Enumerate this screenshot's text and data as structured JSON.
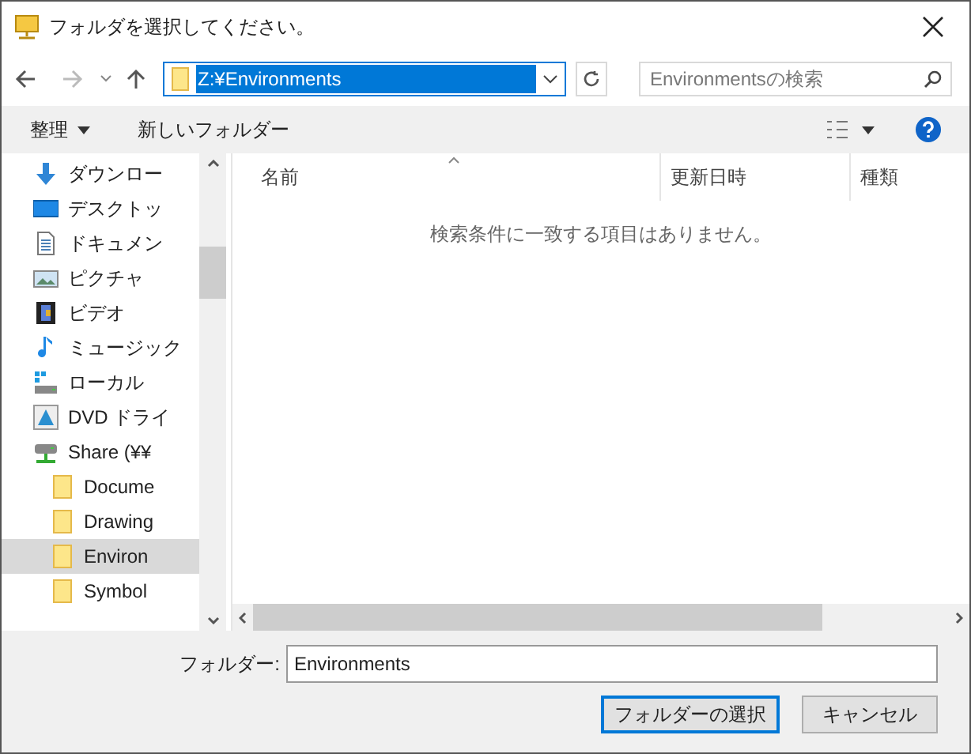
{
  "window": {
    "title": "フォルダを選択してください。"
  },
  "address": {
    "value": "Z:¥Environments"
  },
  "search": {
    "placeholder": "Environmentsの検索"
  },
  "toolbar": {
    "organize": "整理",
    "new_folder": "新しいフォルダー"
  },
  "nav": [
    {
      "label": "ダウンロー",
      "kind": "download",
      "selected": false
    },
    {
      "label": "デスクトッ",
      "kind": "desktop",
      "selected": false
    },
    {
      "label": "ドキュメン",
      "kind": "document",
      "selected": false
    },
    {
      "label": "ピクチャ",
      "kind": "picture",
      "selected": false
    },
    {
      "label": "ビデオ",
      "kind": "video",
      "selected": false
    },
    {
      "label": "ミュージック",
      "kind": "music",
      "selected": false
    },
    {
      "label": "ローカル",
      "kind": "drive",
      "selected": false
    },
    {
      "label": "DVD ドライ",
      "kind": "dvd",
      "selected": false
    },
    {
      "label": "Share (¥¥",
      "kind": "network",
      "selected": false,
      "children": [
        {
          "label": "Docume",
          "kind": "folder",
          "selected": false
        },
        {
          "label": "Drawing",
          "kind": "folder",
          "selected": false
        },
        {
          "label": "Environ",
          "kind": "folder",
          "selected": true
        },
        {
          "label": "Symbol",
          "kind": "folder",
          "selected": false
        }
      ]
    }
  ],
  "columns": [
    "名前",
    "更新日時",
    "種類"
  ],
  "empty_message": "検索条件に一致する項目はありません。",
  "folder_field": {
    "label": "フォルダー:",
    "value": "Environments"
  },
  "buttons": [
    "フォルダーの選択",
    "キャンセル"
  ]
}
